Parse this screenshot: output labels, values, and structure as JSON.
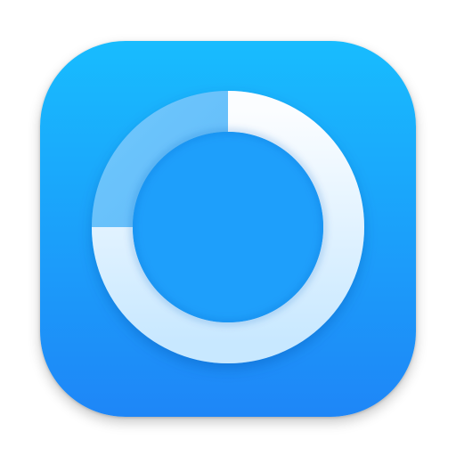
{
  "app_icon": {
    "icon": "progress-ring-icon",
    "progress_fraction": 0.75,
    "colors": {
      "background_top": "#18BCFE",
      "background_bottom": "#1E86F7",
      "ring_filled_top": "#FBFDFF",
      "ring_filled_bottom": "#C8E8FF",
      "ring_track": "#6FC6FC",
      "ring_track_dark": "#52B0F6",
      "center": "#1E9FFB"
    }
  }
}
